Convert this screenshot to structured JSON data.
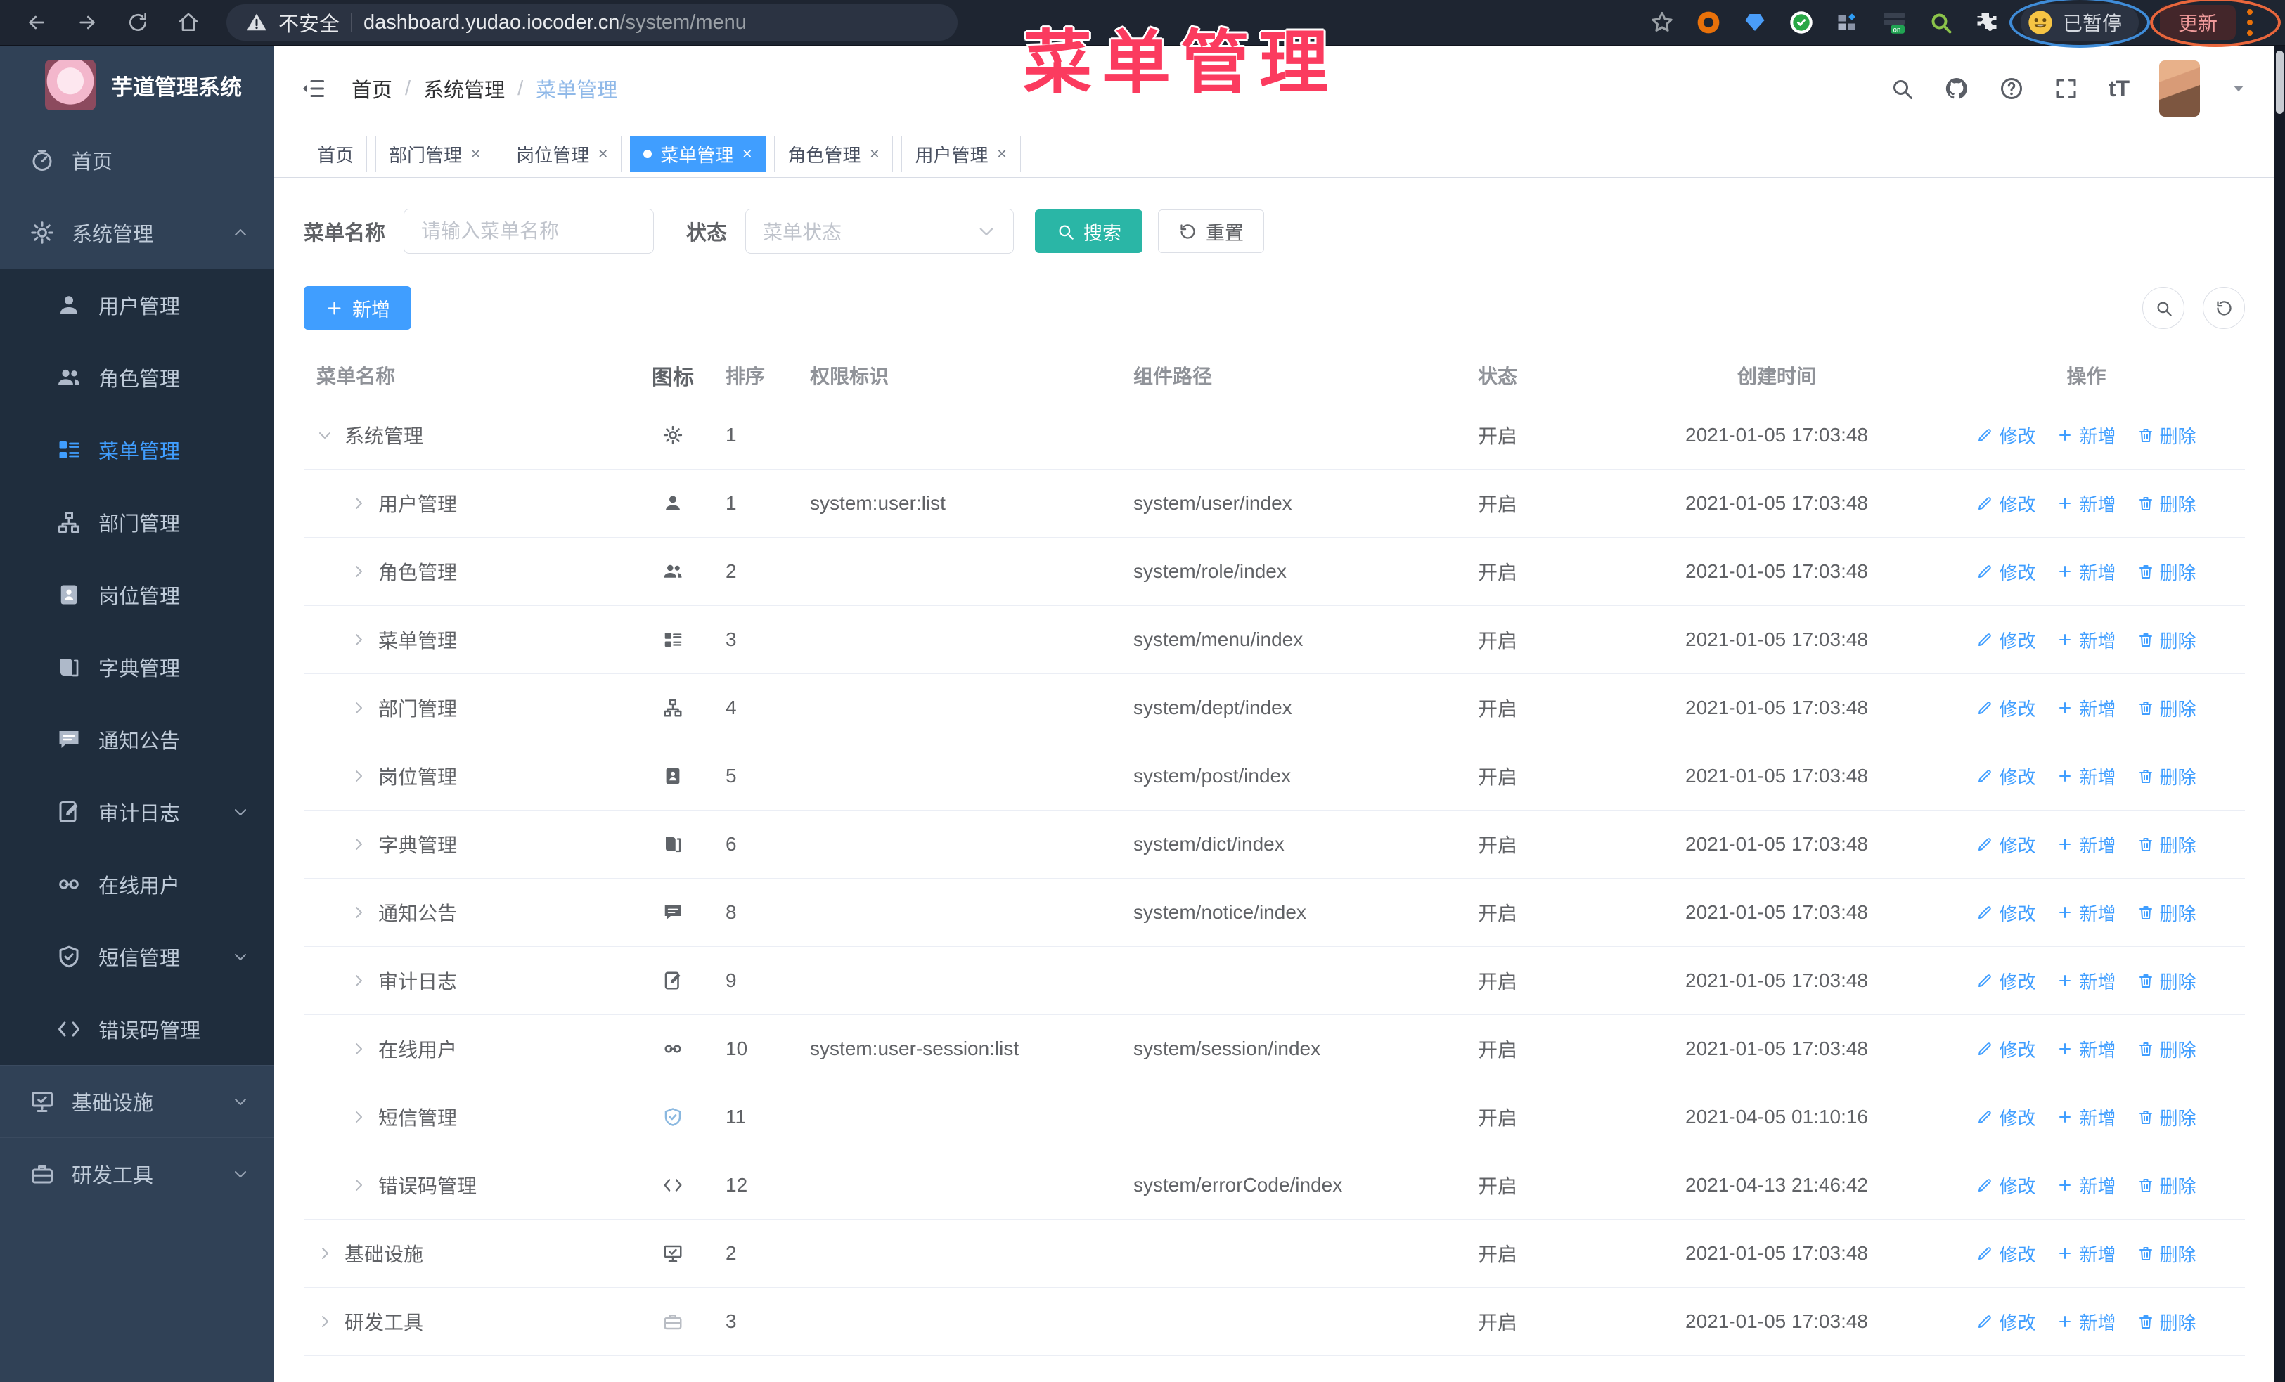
{
  "colors": {
    "accent": "#409eff",
    "search_button": "#2ab6a6",
    "annotation_pink": "#fb3b5f",
    "sidebar_bg": "#304156",
    "submenu_bg": "#1f2d3d"
  },
  "browser": {
    "security_label": "不安全",
    "url_host": "dashboard.yudao.iocoder.cn",
    "url_path": "/system/menu",
    "extension_on_badge": "on",
    "paused_badge": "已暂停",
    "update_button": "更新"
  },
  "annotation": {
    "title": "菜单管理"
  },
  "sidebar": {
    "app_title": "芋道管理系统",
    "items": [
      {
        "label": "首页",
        "icon": "dashboard",
        "level": 0
      },
      {
        "label": "系统管理",
        "icon": "gear",
        "level": 0,
        "arrow": "chev-up"
      },
      {
        "label": "用户管理",
        "icon": "user",
        "level": 1
      },
      {
        "label": "角色管理",
        "icon": "users",
        "level": 1
      },
      {
        "label": "菜单管理",
        "icon": "menu-list",
        "level": 1,
        "active": true
      },
      {
        "label": "部门管理",
        "icon": "tree",
        "level": 1
      },
      {
        "label": "岗位管理",
        "icon": "badge",
        "level": 1
      },
      {
        "label": "字典管理",
        "icon": "book",
        "level": 1
      },
      {
        "label": "通知公告",
        "icon": "message",
        "level": 1
      },
      {
        "label": "审计日志",
        "icon": "edit-doc",
        "level": 1,
        "arrow": "chev-down"
      },
      {
        "label": "在线用户",
        "icon": "link",
        "level": 1
      },
      {
        "label": "短信管理",
        "icon": "shield",
        "level": 1,
        "arrow": "chev-down"
      },
      {
        "label": "错误码管理",
        "icon": "code",
        "level": 1
      },
      {
        "label": "基础设施",
        "icon": "board",
        "level": 0,
        "arrow": "chev-down",
        "sep": true
      },
      {
        "label": "研发工具",
        "icon": "toolbox",
        "level": 0,
        "arrow": "chev-down",
        "sep": true
      }
    ]
  },
  "header": {
    "breadcrumb": [
      "首页",
      "系统管理",
      "菜单管理"
    ]
  },
  "tabs": [
    {
      "label": "首页",
      "closable": false,
      "active": false
    },
    {
      "label": "部门管理",
      "closable": true,
      "active": false
    },
    {
      "label": "岗位管理",
      "closable": true,
      "active": false
    },
    {
      "label": "菜单管理",
      "closable": true,
      "active": true
    },
    {
      "label": "角色管理",
      "closable": true,
      "active": false
    },
    {
      "label": "用户管理",
      "closable": true,
      "active": false
    }
  ],
  "filters": {
    "name_label": "菜单名称",
    "name_placeholder": "请输入菜单名称",
    "status_label": "状态",
    "status_placeholder": "菜单状态",
    "search_label": "搜索",
    "reset_label": "重置"
  },
  "toolbar": {
    "add_label": "新增"
  },
  "table": {
    "columns": [
      "菜单名称",
      "图标",
      "排序",
      "权限标识",
      "组件路径",
      "状态",
      "创建时间",
      "操作"
    ],
    "ops": [
      "修改",
      "新增",
      "删除"
    ],
    "rows": [
      {
        "name": "系统管理",
        "icon": "gear",
        "level": 0,
        "expand": "chev-down",
        "order": "1",
        "perm": "",
        "path": "",
        "status": "开启",
        "time": "2021-01-05 17:03:48"
      },
      {
        "name": "用户管理",
        "icon": "user",
        "level": 1,
        "expand": "chev-right",
        "order": "1",
        "perm": "system:user:list",
        "path": "system/user/index",
        "status": "开启",
        "time": "2021-01-05 17:03:48"
      },
      {
        "name": "角色管理",
        "icon": "users",
        "level": 1,
        "expand": "chev-right",
        "order": "2",
        "perm": "",
        "path": "system/role/index",
        "status": "开启",
        "time": "2021-01-05 17:03:48"
      },
      {
        "name": "菜单管理",
        "icon": "menu-list",
        "level": 1,
        "expand": "chev-right",
        "order": "3",
        "perm": "",
        "path": "system/menu/index",
        "status": "开启",
        "time": "2021-01-05 17:03:48"
      },
      {
        "name": "部门管理",
        "icon": "tree",
        "level": 1,
        "expand": "chev-right",
        "order": "4",
        "perm": "",
        "path": "system/dept/index",
        "status": "开启",
        "time": "2021-01-05 17:03:48"
      },
      {
        "name": "岗位管理",
        "icon": "badge",
        "level": 1,
        "expand": "chev-right",
        "order": "5",
        "perm": "",
        "path": "system/post/index",
        "status": "开启",
        "time": "2021-01-05 17:03:48"
      },
      {
        "name": "字典管理",
        "icon": "book",
        "level": 1,
        "expand": "chev-right",
        "order": "6",
        "perm": "",
        "path": "system/dict/index",
        "status": "开启",
        "time": "2021-01-05 17:03:48"
      },
      {
        "name": "通知公告",
        "icon": "message",
        "level": 1,
        "expand": "chev-right",
        "order": "8",
        "perm": "",
        "path": "system/notice/index",
        "status": "开启",
        "time": "2021-01-05 17:03:48"
      },
      {
        "name": "审计日志",
        "icon": "edit-doc",
        "level": 1,
        "expand": "chev-right",
        "order": "9",
        "perm": "",
        "path": "",
        "status": "开启",
        "time": "2021-01-05 17:03:48"
      },
      {
        "name": "在线用户",
        "icon": "link",
        "level": 1,
        "expand": "chev-right",
        "order": "10",
        "perm": "system:user-session:list",
        "path": "system/session/index",
        "status": "开启",
        "time": "2021-01-05 17:03:48"
      },
      {
        "name": "短信管理",
        "icon": "shield",
        "level": 1,
        "expand": "chev-right",
        "order": "11",
        "perm": "",
        "path": "",
        "status": "开启",
        "time": "2021-04-05 01:10:16",
        "icon_tint": "shield-tint"
      },
      {
        "name": "错误码管理",
        "icon": "code",
        "level": 1,
        "expand": "chev-right",
        "order": "12",
        "perm": "",
        "path": "system/errorCode/index",
        "status": "开启",
        "time": "2021-04-13 21:46:42"
      },
      {
        "name": "基础设施",
        "icon": "board",
        "level": 0,
        "expand": "chev-right",
        "order": "2",
        "perm": "",
        "path": "",
        "status": "开启",
        "time": "2021-01-05 17:03:48"
      },
      {
        "name": "研发工具",
        "icon": "toolbox",
        "level": 0,
        "expand": "chev-right",
        "order": "3",
        "perm": "",
        "path": "",
        "status": "开启",
        "time": "2021-01-05 17:03:48",
        "icon_tint": "tool-tint"
      }
    ]
  }
}
